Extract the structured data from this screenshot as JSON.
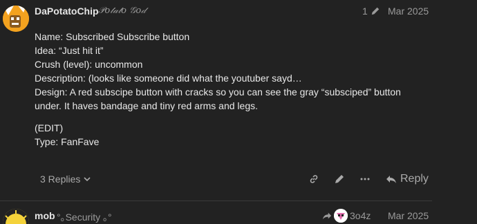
{
  "post1": {
    "username": "DaPotatoChip",
    "user_title": "𝒫𝑜𝓉𝒶𝓉𝑜 𝒢𝑜𝒹",
    "edit_count": "1",
    "date": "Mar 2025",
    "lines": [
      "Name: Subscribed Subscribe button",
      "Idea: “Just hit it”",
      "Crush (level): uncommon",
      "Description: (looks like someone did what the youtuber sayd…",
      "Design: A red subscipe button with cracks so you can see the gray “subsciped” button under. It haves bandage and tiny red arms and legs."
    ],
    "lines2": [
      "(EDIT)",
      "Type: FanFave"
    ],
    "replies_label": "3 Replies",
    "reply_label": "Reply"
  },
  "post2": {
    "username": "mob",
    "user_title": "°｡Security ｡°",
    "reply_to_user": "3o4z",
    "date": "Mar 2025"
  }
}
